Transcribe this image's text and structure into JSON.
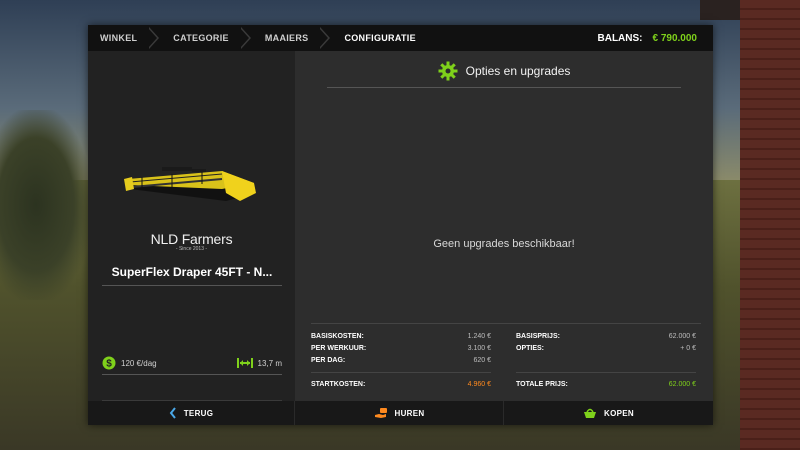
{
  "breadcrumb": [
    "WINKEL",
    "CATEGORIE",
    "MAAIERS",
    "CONFIGURATIE"
  ],
  "balance": {
    "label": "BALANS:",
    "amount": "€ 790.000"
  },
  "product": {
    "brand_name": "NLD Farmers",
    "brand_since": "- Since 2013 -",
    "title": "SuperFlex Draper 45FT - N...",
    "stats": [
      {
        "icon": "dollar-icon",
        "value": "120 €/dag"
      },
      {
        "icon": "width-icon",
        "value": "13,7 m"
      }
    ]
  },
  "options": {
    "title": "Opties en upgrades",
    "empty_message": "Geen upgrades beschikbaar!"
  },
  "costs": {
    "left": [
      {
        "label": "BASISKOSTEN:",
        "value": "1.240 €"
      },
      {
        "label": "PER WERKUUR:",
        "value": "3.100 €"
      },
      {
        "label": "PER DAG:",
        "value": "620 €"
      }
    ],
    "left_total": {
      "label": "STARTKOSTEN:",
      "value": "4.960 €"
    },
    "right": [
      {
        "label": "BASISPRIJS:",
        "value": "62.000 €"
      },
      {
        "label": "OPTIES:",
        "value": "+ 0 €"
      }
    ],
    "right_total": {
      "label": "TOTALE PRIJS:",
      "value": "62.000 €"
    }
  },
  "buttons": {
    "back": "TERUG",
    "rent": "HUREN",
    "buy": "KOPEN"
  },
  "colors": {
    "accent_green": "#7fd11b",
    "accent_orange": "#ff8a1f"
  }
}
